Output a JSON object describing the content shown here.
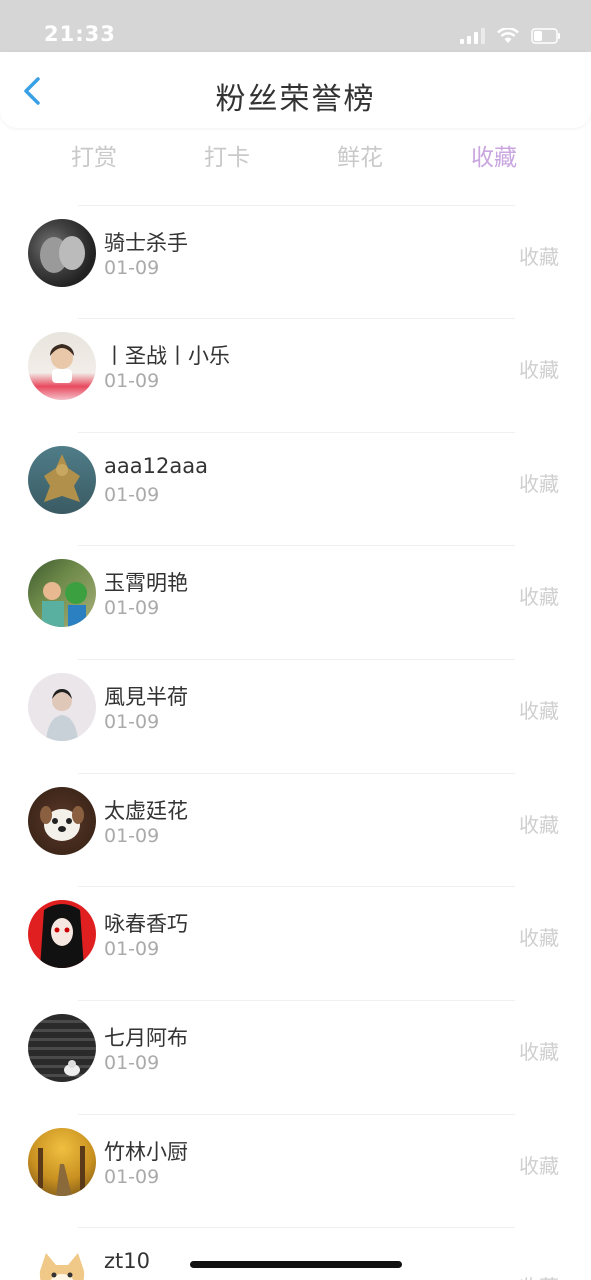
{
  "status_bar": {
    "time": "21:33"
  },
  "header": {
    "title": "粉丝荣誉榜"
  },
  "tabs": [
    {
      "label": "打赏",
      "active": false
    },
    {
      "label": "打卡",
      "active": false
    },
    {
      "label": "鲜花",
      "active": false
    },
    {
      "label": "收藏",
      "active": true
    }
  ],
  "colors": {
    "active_tab": "#c9a6e0",
    "inactive_text": "#c9c9c9",
    "back_icon": "#3aa0e6"
  },
  "list": [
    {
      "name": "骑士杀手",
      "date": "01-09",
      "action": "收藏",
      "avatar": "couple-photo"
    },
    {
      "name": "丨圣战丨小乐",
      "date": "01-09",
      "action": "收藏",
      "avatar": "girl-photo"
    },
    {
      "name": "aaa12aaa",
      "date": "01-09",
      "action": "收藏",
      "avatar": "statue-photo"
    },
    {
      "name": "玉霄明艳",
      "date": "01-09",
      "action": "收藏",
      "avatar": "children-photo"
    },
    {
      "name": "風見半荷",
      "date": "01-09",
      "action": "收藏",
      "avatar": "boy-photo"
    },
    {
      "name": "太虚廷花",
      "date": "01-09",
      "action": "收藏",
      "avatar": "dog-photo"
    },
    {
      "name": "咏春香巧",
      "date": "01-09",
      "action": "收藏",
      "avatar": "anime-girl-photo"
    },
    {
      "name": "七月阿布",
      "date": "01-09",
      "action": "收藏",
      "avatar": "stairs-cat-photo"
    },
    {
      "name": "竹林小厨",
      "date": "01-09",
      "action": "收藏",
      "avatar": "autumn-road-photo"
    },
    {
      "name": "zt10",
      "date": "",
      "action": "收藏",
      "avatar": "cartoon-dog"
    }
  ]
}
